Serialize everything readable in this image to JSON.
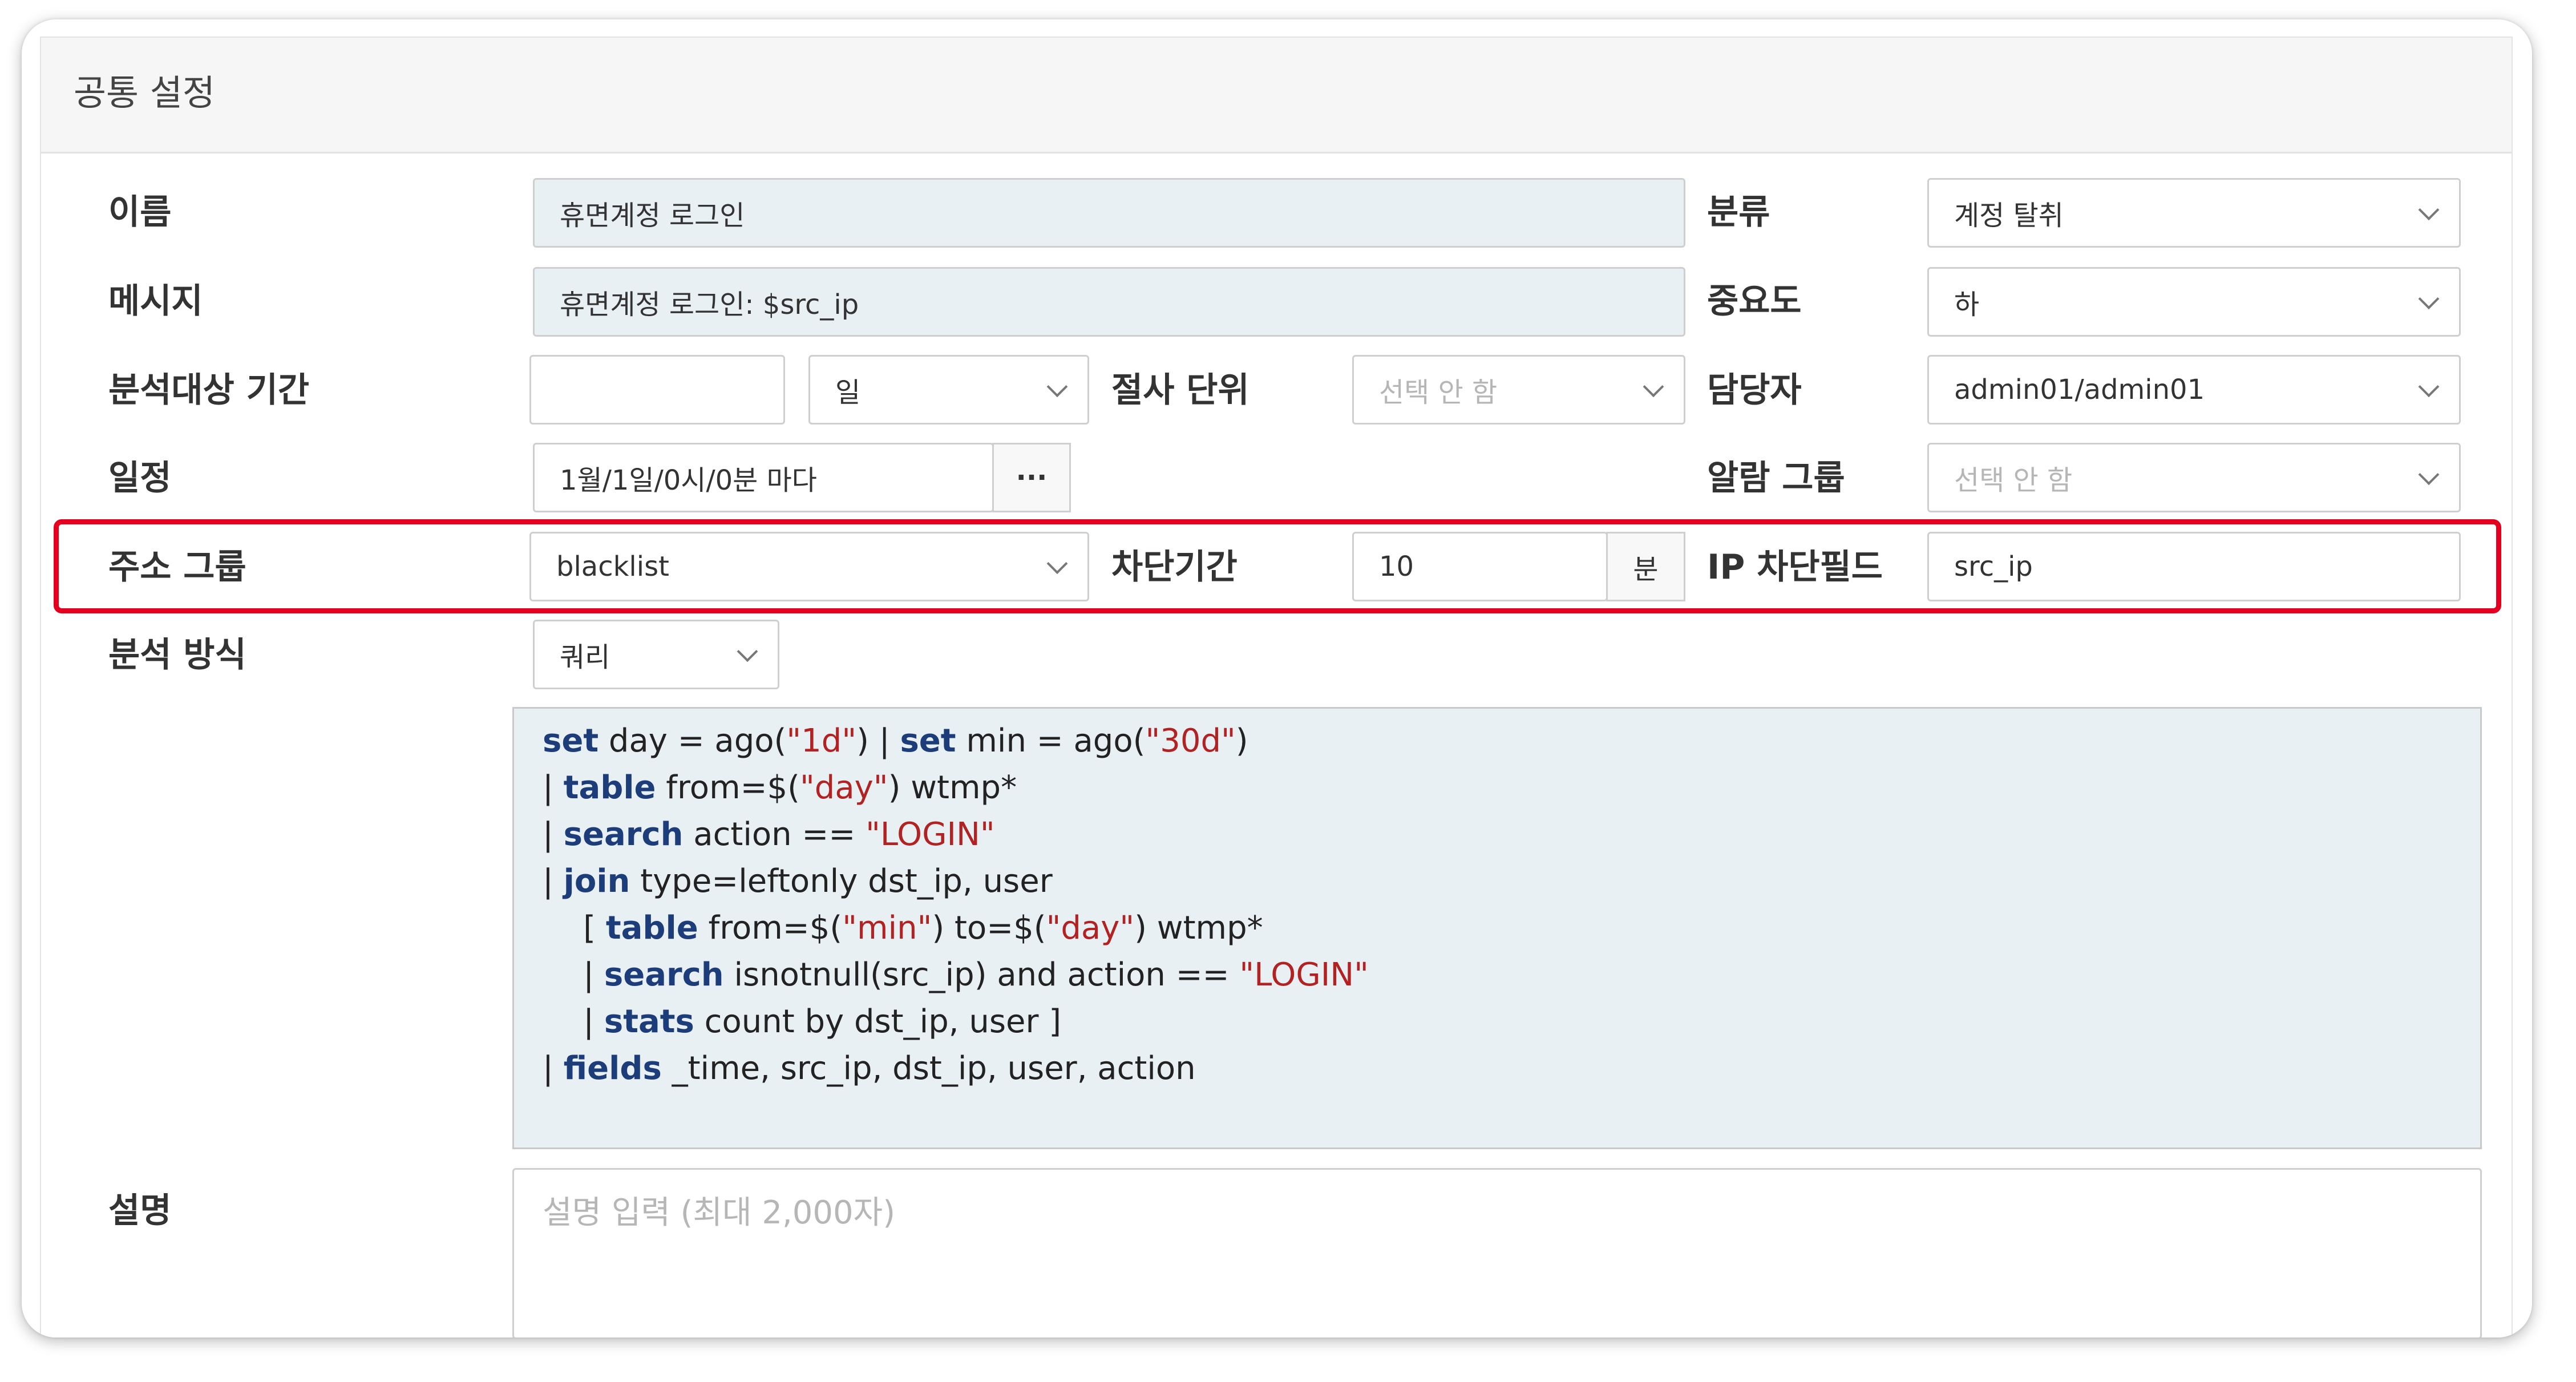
{
  "panel": {
    "title": "공통 설정"
  },
  "labels": {
    "name": "이름",
    "message": "메시지",
    "period": "분석대상 기간",
    "cut_unit": "절사 단위",
    "schedule": "일정",
    "address_group": "주소 그룹",
    "block_period": "차단기간",
    "analysis_method": "분석 방식",
    "description": "설명",
    "category": "분류",
    "severity": "중요도",
    "assignee": "담당자",
    "alarm_group": "알람 그룹",
    "ip_block_field": "IP 차단필드"
  },
  "fields": {
    "name_value": "휴면계정 로그인",
    "message_value": "휴면계정 로그인: $src_ip",
    "period_value": "",
    "period_unit": "일",
    "cut_unit_placeholder": "선택 안 함",
    "schedule_value": "1월/1일/0시/0분 마다",
    "schedule_button": "···",
    "category_value": "계정 탈취",
    "severity_value": "하",
    "assignee_value": "admin01/admin01",
    "alarm_group_placeholder": "선택 안 함",
    "address_group_value": "blacklist",
    "block_period_value": "10",
    "block_period_unit": "분",
    "ip_block_field_value": "src_ip",
    "analysis_method_value": "쿼리",
    "description_placeholder": "설명 입력 (최대 2,000자)"
  },
  "query": {
    "l1": {
      "k1": "set",
      "t1": " day = ago(",
      "s1": "\"1d\"",
      "t2": ") | ",
      "k2": "set",
      "t3": " min = ago(",
      "s2": "\"30d\"",
      "t4": ")"
    },
    "l2": {
      "t0": "| ",
      "k1": "table",
      "t1": " from=$(",
      "s1": "\"day\"",
      "t2": ") wtmp*"
    },
    "l3": {
      "t0": "| ",
      "k1": "search",
      "t1": " action == ",
      "s1": "\"LOGIN\""
    },
    "l4": {
      "t0": "| ",
      "k1": "join",
      "t1": " type=leftonly dst_ip, user"
    },
    "l5": {
      "t0": "    [ ",
      "k1": "table",
      "t1": " from=$(",
      "s1": "\"min\"",
      "t2": ") to=$(",
      "s2": "\"day\"",
      "t3": ") wtmp*"
    },
    "l6": {
      "t0": "    | ",
      "k1": "search",
      "t1": " isnotnull(src_ip) and action == ",
      "s1": "\"LOGIN\""
    },
    "l7": {
      "t0": "    | ",
      "k1": "stats",
      "t1": " count by dst_ip, user ]"
    },
    "l8": {
      "t0": "| ",
      "k1": "fields",
      "t1": " _time, src_ip, dst_ip, user, action"
    }
  },
  "colors": {
    "highlight": "#e4001e",
    "keyword": "#1d3c7a",
    "string": "#b22222"
  }
}
